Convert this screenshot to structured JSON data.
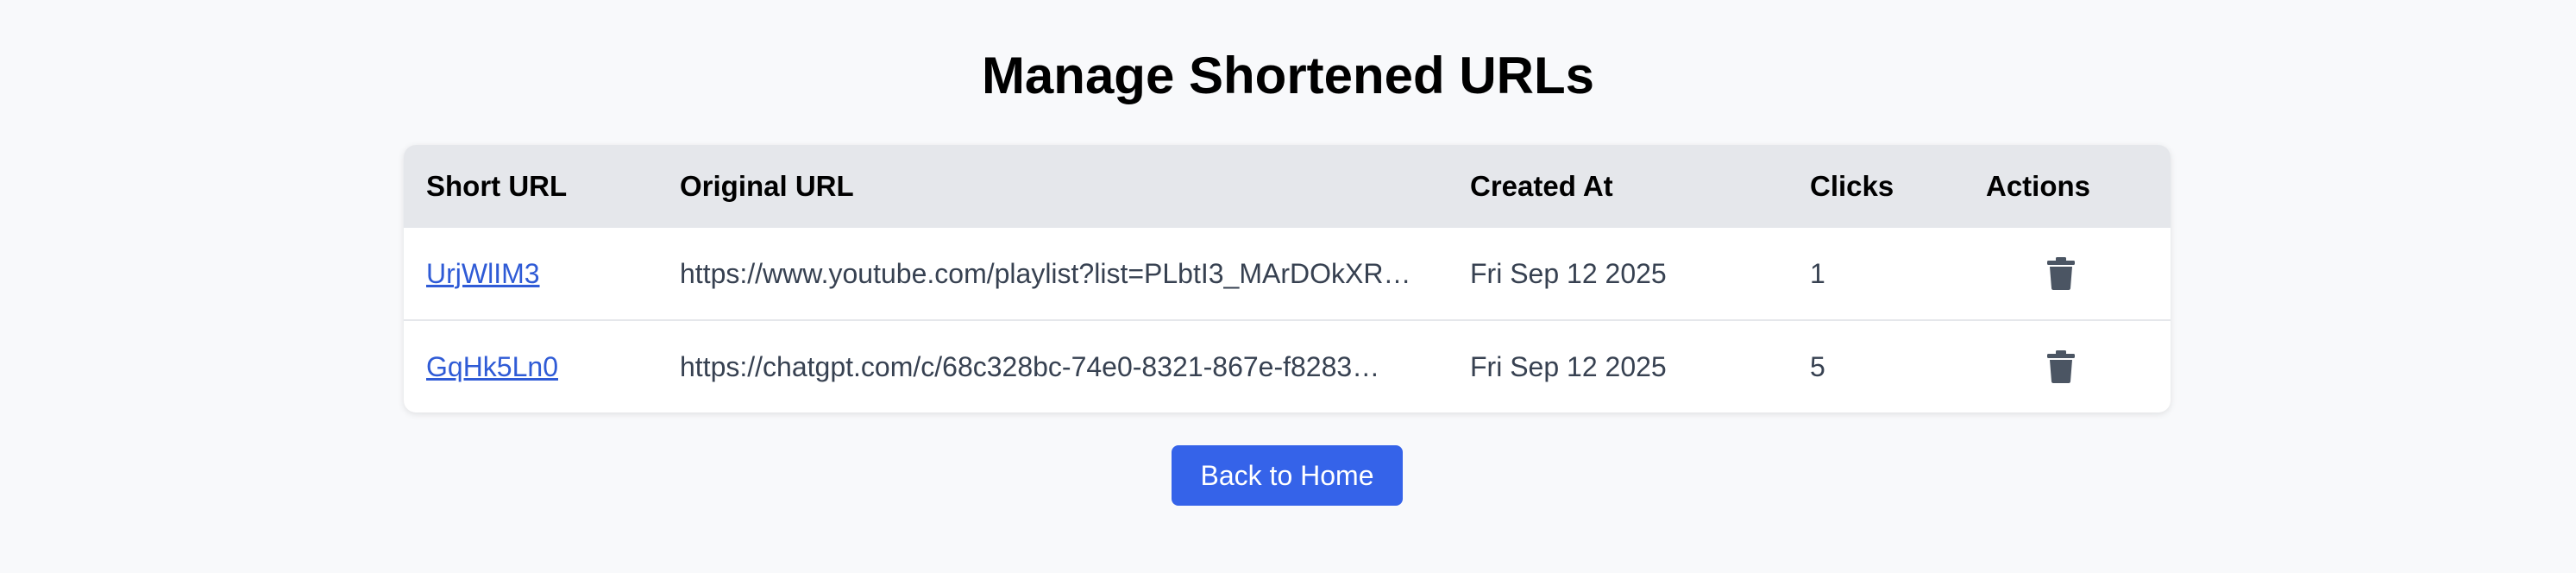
{
  "page": {
    "title": "Manage Shortened URLs"
  },
  "table": {
    "headers": {
      "short_url": "Short URL",
      "original_url": "Original URL",
      "created_at": "Created At",
      "clicks": "Clicks",
      "actions": "Actions"
    },
    "rows": [
      {
        "short_url": "UrjWlIM3",
        "original_url": "https://www.youtube.com/playlist?list=PLbtI3_MArDOkXR…",
        "created_at": "Fri Sep 12 2025",
        "clicks": "1",
        "action_icon": "trash-icon"
      },
      {
        "short_url": "GqHk5Ln0",
        "original_url": "https://chatgpt.com/c/68c328bc-74e0-8321-867e-f8283…",
        "created_at": "Fri Sep 12 2025",
        "clicks": "5",
        "action_icon": "trash-icon"
      }
    ]
  },
  "footer": {
    "back_button_label": "Back to Home"
  },
  "colors": {
    "accent": "#3563e9",
    "link": "#2f5bd6",
    "header_bg": "#e5e7eb",
    "page_bg": "#f8f9fb",
    "icon": "#4b5563"
  }
}
